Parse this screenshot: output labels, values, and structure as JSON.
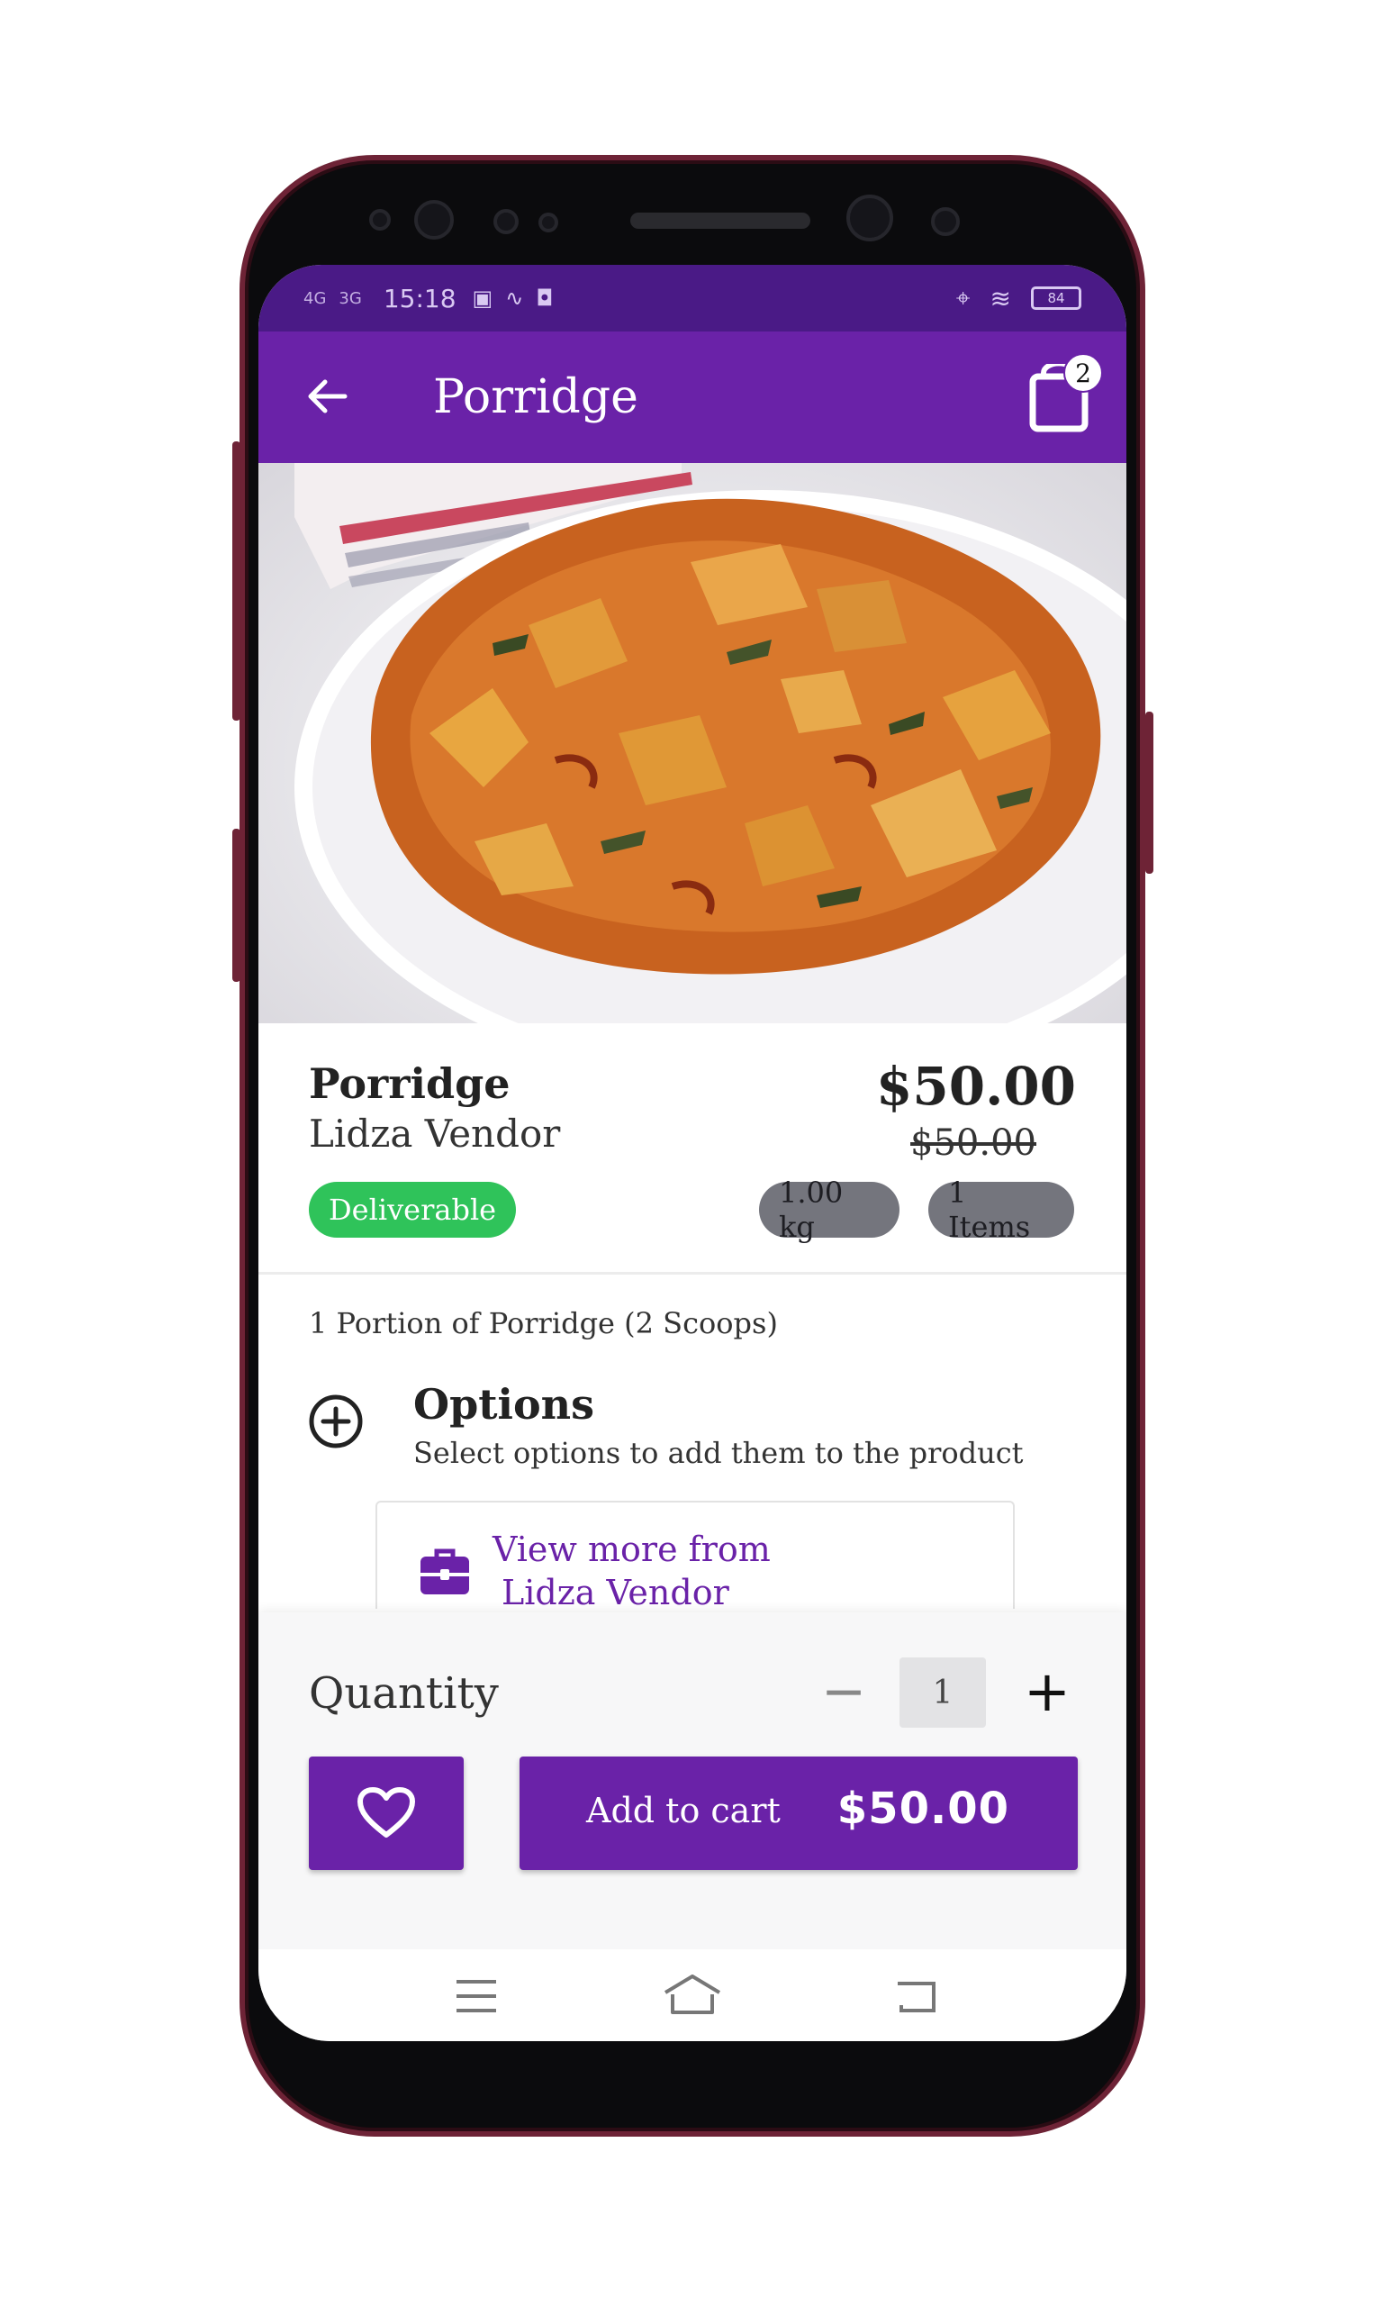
{
  "status_bar": {
    "signal_1": "4G",
    "signal_2": "3G",
    "time": "15:18",
    "battery": "84"
  },
  "app_bar": {
    "title": "Porridge",
    "cart_count": "2"
  },
  "product": {
    "name": "Porridge",
    "vendor": "Lidza Vendor",
    "price": "$50.00",
    "old_price": "$50.00",
    "delivery_badge": "Deliverable",
    "weight": "1.00 kg",
    "items": "1 Items",
    "description": "1 Portion of Porridge (2 Scoops)"
  },
  "options": {
    "title": "Options",
    "subtitle": "Select options to add them to the product"
  },
  "vendor_link": {
    "line1": "View more from",
    "line2": "Lidza Vendor"
  },
  "quantity": {
    "label": "Quantity",
    "minus": "−",
    "value": "1",
    "plus": "+"
  },
  "actions": {
    "add_to_cart_label": "Add to cart",
    "add_to_cart_amount": "$50.00"
  },
  "colors": {
    "primary": "#6a22a8",
    "status_bar": "#4a1a86",
    "deliverable": "#2fc35a",
    "chip_grey": "#74757d"
  },
  "icons": [
    "back-arrow-icon",
    "shopping-bag-icon",
    "plus-circle-icon",
    "briefcase-icon",
    "heart-icon",
    "menu-icon",
    "home-icon",
    "back-icon"
  ]
}
